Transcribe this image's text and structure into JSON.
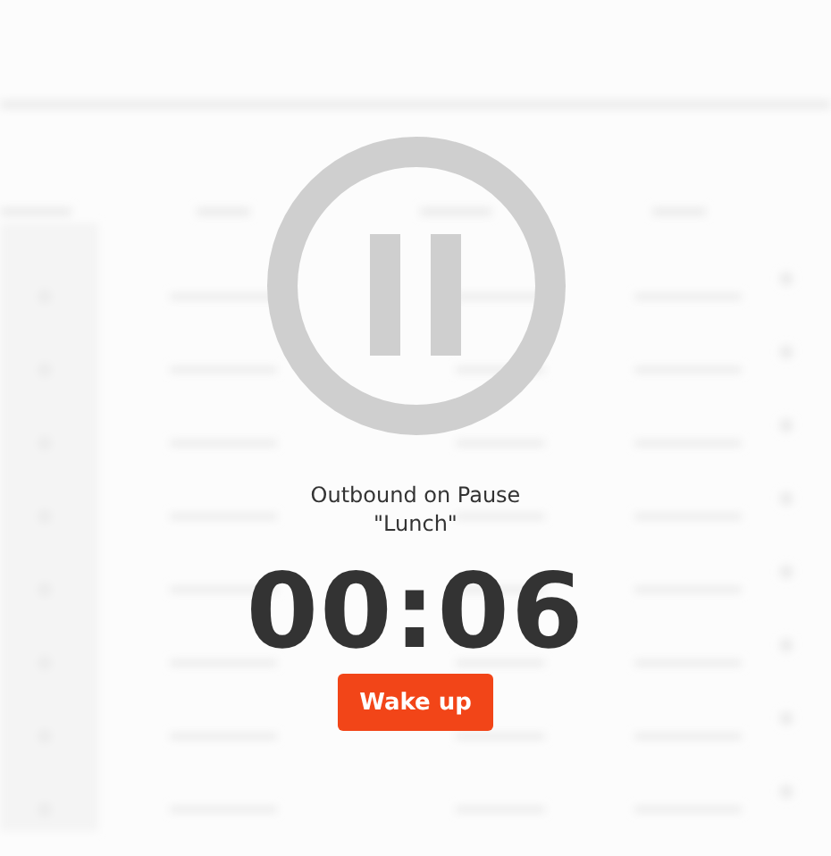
{
  "status": {
    "title": "Outbound on Pause",
    "reason": "\"Lunch\""
  },
  "timer": "00:06",
  "wake_button": {
    "label": "Wake up"
  }
}
